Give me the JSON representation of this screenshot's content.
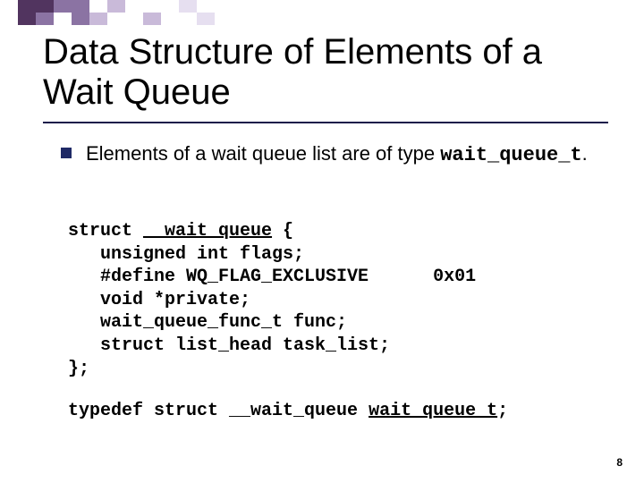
{
  "title": "Data Structure of Elements of a Wait Queue",
  "bullet": {
    "text_before": "Elements of a wait queue list are of type ",
    "type_name": "wait_queue_t",
    "text_after": "."
  },
  "code": {
    "l1_pre": "struct ",
    "l1_u": "__wait_queue",
    "l1_post": " {",
    "l2": "   unsigned int flags;",
    "l3": "   #define WQ_FLAG_EXCLUSIVE      0x01",
    "l4": "   void *private;",
    "l5": "   wait_queue_func_t func;",
    "l6": "   struct list_head task_list;",
    "l7": "};"
  },
  "typedef": {
    "pre": "typedef struct __wait_queue ",
    "u": "wait_queue_t",
    "post": ";"
  },
  "page_number": "8"
}
